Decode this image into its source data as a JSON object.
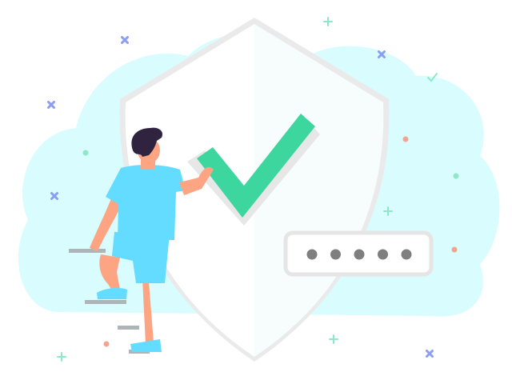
{
  "illustration": {
    "colors": {
      "background": "#ffffff",
      "cloud": "#d9fcff",
      "shield_left": "#ffffff",
      "shield_right": "#f7fcfd",
      "shield_shadow": "#eaeaea",
      "check": "#3dd69e",
      "check_shadow": "#e7e7e7",
      "password_border": "#e5e5e5",
      "password_dot": "#7f7f7f",
      "shirt": "#63dcff",
      "skin": "#fda482",
      "hair": "#2f2340",
      "stairs": "#aeb5b8",
      "sparkle_green": "#8ee8c8",
      "sparkle_blue": "#8a9ef2",
      "sparkle_red": "#f2a491"
    },
    "password": {
      "masked_length": 5
    },
    "icons": [
      "shield-icon",
      "check-mark-icon",
      "password-field-icon",
      "person-figure",
      "stair-steps",
      "sparkle-decoration"
    ]
  }
}
